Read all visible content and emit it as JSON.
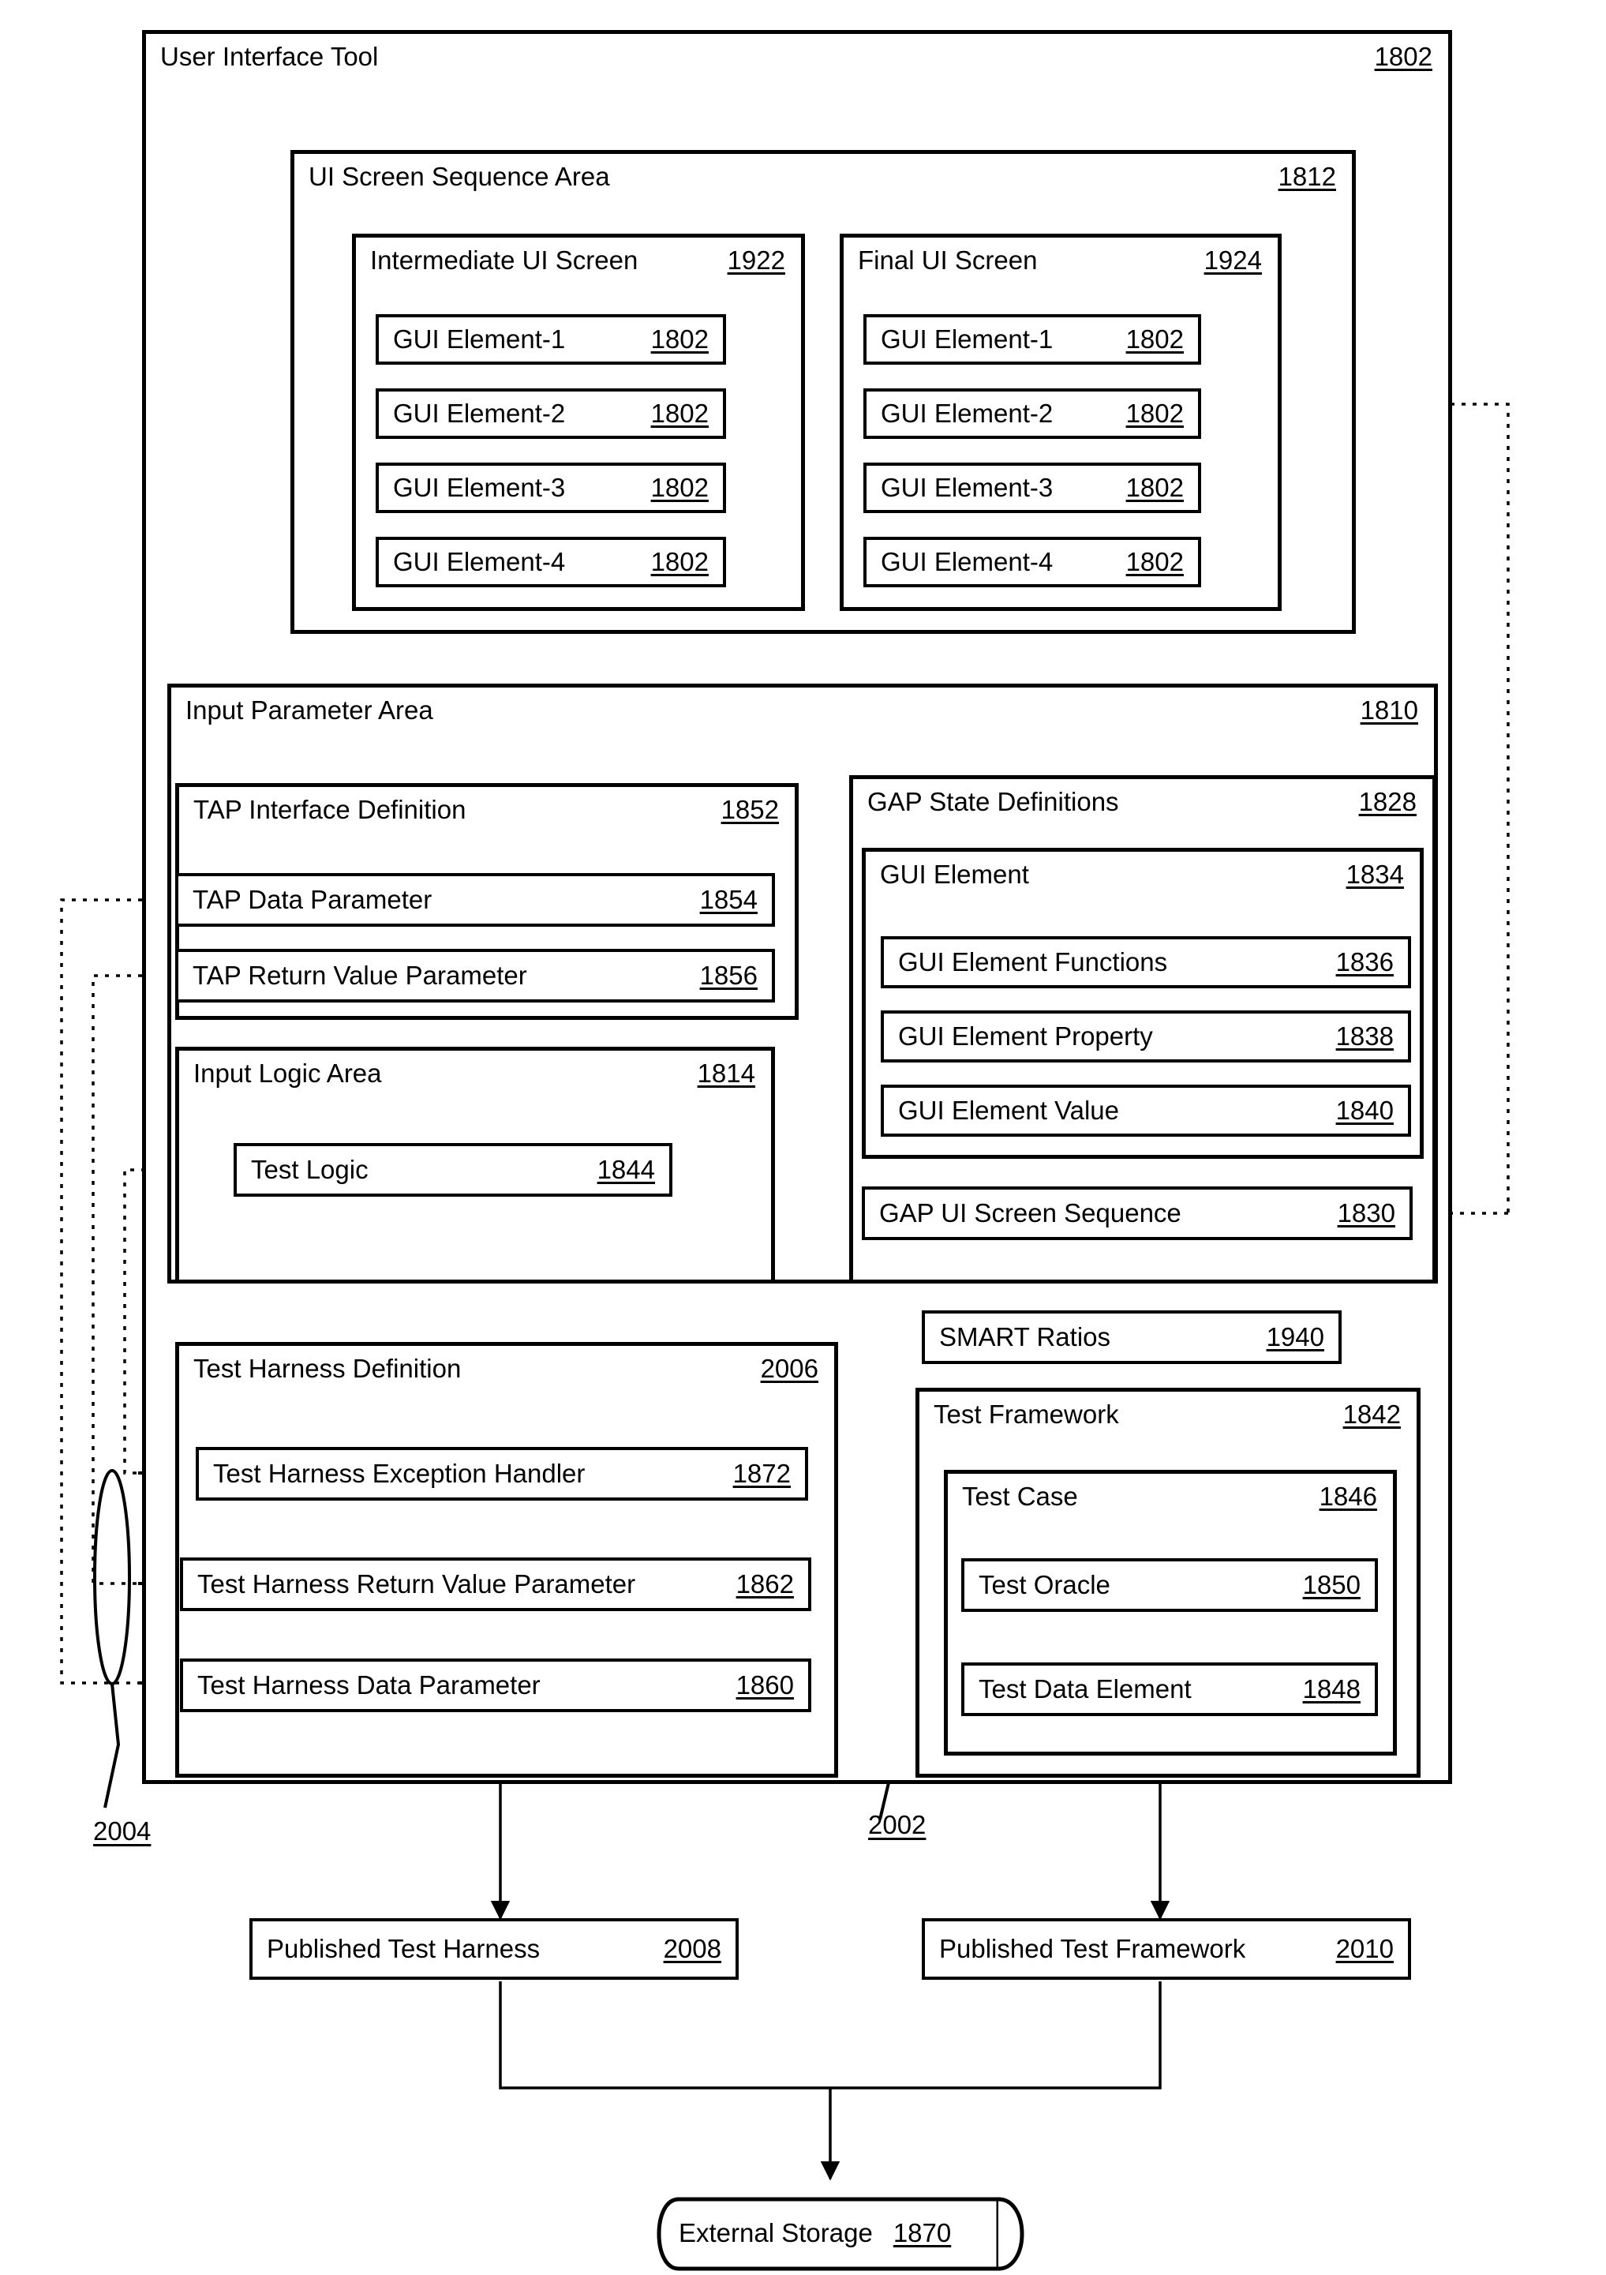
{
  "figure": {
    "root": {
      "title": "User Interface Tool",
      "ref": "1802"
    },
    "ui_screen_sequence_area": {
      "title": "UI Screen Sequence Area",
      "ref": "1812",
      "screens": [
        {
          "title": "Intermediate UI Screen",
          "ref": "1922",
          "elements": [
            {
              "label": "GUI Element-1",
              "ref": "1802"
            },
            {
              "label": "GUI Element-2",
              "ref": "1802"
            },
            {
              "label": "GUI Element-3",
              "ref": "1802"
            },
            {
              "label": "GUI Element-4",
              "ref": "1802"
            }
          ]
        },
        {
          "title": "Final UI Screen",
          "ref": "1924",
          "elements": [
            {
              "label": "GUI Element-1",
              "ref": "1802"
            },
            {
              "label": "GUI Element-2",
              "ref": "1802"
            },
            {
              "label": "GUI Element-3",
              "ref": "1802"
            },
            {
              "label": "GUI Element-4",
              "ref": "1802"
            }
          ]
        }
      ]
    },
    "input_parameter_area": {
      "title": "Input Parameter Area",
      "ref": "1810",
      "tap_interface_definition": {
        "title": "TAP Interface Definition",
        "ref": "1852",
        "items": [
          {
            "label": "TAP Data Parameter",
            "ref": "1854"
          },
          {
            "label": "TAP Return Value Parameter",
            "ref": "1856"
          }
        ]
      },
      "input_logic_area": {
        "title": "Input Logic Area",
        "ref": "1814",
        "items": [
          {
            "label": "Test Logic",
            "ref": "1844"
          }
        ]
      },
      "gap_state_definitions": {
        "title": "GAP State Definitions",
        "ref": "1828",
        "gui_element": {
          "title": "GUI Element",
          "ref": "1834",
          "items": [
            {
              "label": "GUI Element Functions",
              "ref": "1836"
            },
            {
              "label": "GUI Element Property",
              "ref": "1838"
            },
            {
              "label": "GUI Element Value",
              "ref": "1840"
            }
          ]
        },
        "gap_ui_screen_sequence": {
          "label": "GAP UI Screen Sequence",
          "ref": "1830"
        }
      }
    },
    "test_harness_definition": {
      "title": "Test Harness Definition",
      "ref": "2006",
      "items": [
        {
          "label": "Test Harness Exception Handler",
          "ref": "1872"
        },
        {
          "label": "Test Harness Return Value  Parameter",
          "ref": "1862"
        },
        {
          "label": "Test Harness Data Parameter",
          "ref": "1860"
        }
      ]
    },
    "smart_ratios": {
      "label": "SMART Ratios",
      "ref": "1940"
    },
    "test_framework": {
      "title": "Test Framework",
      "ref": "1842",
      "test_case": {
        "title": "Test Case",
        "ref": "1846",
        "items": [
          {
            "label": "Test Oracle",
            "ref": "1850"
          },
          {
            "label": "Test Data Element",
            "ref": "1848"
          }
        ]
      }
    },
    "bundle_labels": [
      {
        "ref": "2004"
      },
      {
        "ref": "2002"
      }
    ],
    "outputs": [
      {
        "label": "Published Test Harness",
        "ref": "2008"
      },
      {
        "label": "Published Test Framework",
        "ref": "2010"
      }
    ],
    "external_storage": {
      "label": "External Storage",
      "ref": "1870"
    }
  }
}
